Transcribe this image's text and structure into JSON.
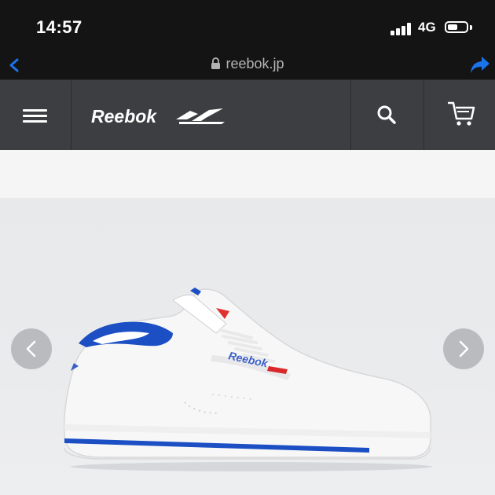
{
  "status_bar": {
    "time": "14:57",
    "network": "4G",
    "battery_level": 0.55
  },
  "browser": {
    "url": "reebok.jp"
  },
  "header": {
    "logo_text": "Reebok"
  },
  "product": {
    "shoe_brand_text": "Reebok"
  },
  "colors": {
    "status_bg": "#141414",
    "header_bg": "#3c3e42",
    "browser_accent": "#1a73e8",
    "shoe_accent": "#1c4fc4"
  },
  "icons": {
    "back": "chevron-left-icon",
    "lock": "lock-icon",
    "share": "share-arrow-icon",
    "menu": "hamburger-menu-icon",
    "search": "search-icon",
    "cart": "cart-icon",
    "prev": "chevron-left-icon",
    "next": "chevron-right-icon"
  }
}
